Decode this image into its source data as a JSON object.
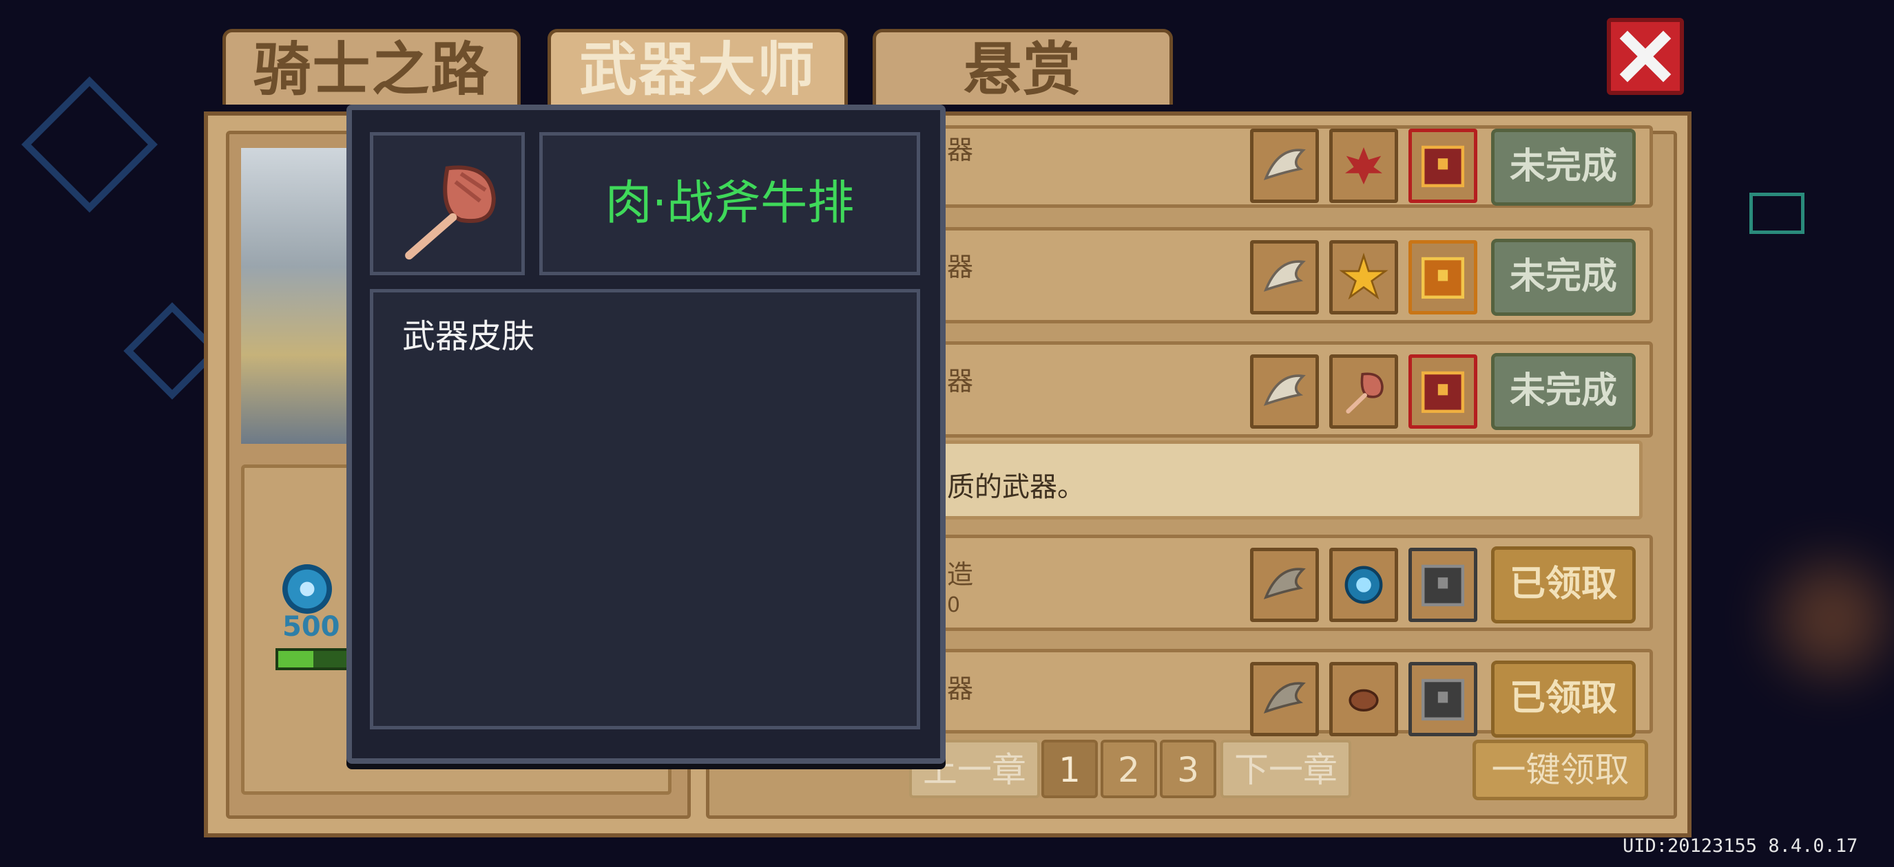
{
  "tabs": [
    {
      "label": "骑士之路",
      "active": false
    },
    {
      "label": "武器大师",
      "active": true
    },
    {
      "label": "悬赏",
      "active": false
    }
  ],
  "close_icon": "close-icon",
  "left_panel": {
    "reward_amount": "500",
    "progress_fraction": 0.5
  },
  "tasks": [
    {
      "title": "器",
      "subtitle": "",
      "items": [
        "wing-icon",
        "maple-leaf-icon",
        "chest-icon"
      ],
      "status": "未完成",
      "state": "incomplete"
    },
    {
      "title": "器",
      "subtitle": "",
      "items": [
        "wing-icon",
        "star-icon",
        "chest-icon"
      ],
      "status": "未完成",
      "state": "incomplete"
    },
    {
      "title": "器",
      "subtitle": "",
      "items": [
        "wing-icon",
        "meat-axe-icon",
        "chest-icon"
      ],
      "status": "未完成",
      "state": "incomplete"
    },
    {
      "title": "造",
      "subtitle": "0",
      "items": [
        "wing-icon",
        "blue-coin-icon",
        "chest-icon"
      ],
      "status": "已领取",
      "state": "claimed"
    },
    {
      "title": "器",
      "subtitle": "",
      "items": [
        "wing-icon",
        "meat-icon",
        "chest-icon"
      ],
      "status": "已领取",
      "state": "claimed"
    }
  ],
  "description": "质的武器。",
  "pagination": {
    "prev": "上一章",
    "pages": [
      "1",
      "2",
      "3"
    ],
    "current": "1",
    "next": "下一章"
  },
  "claim_all": "一键领取",
  "popup": {
    "item_icon": "meat-axe-icon",
    "item_name": "肉·战斧牛排",
    "item_type": "武器皮肤",
    "name_color": "#3fd95a"
  },
  "uid": "UID:20123155 8.4.0.17"
}
